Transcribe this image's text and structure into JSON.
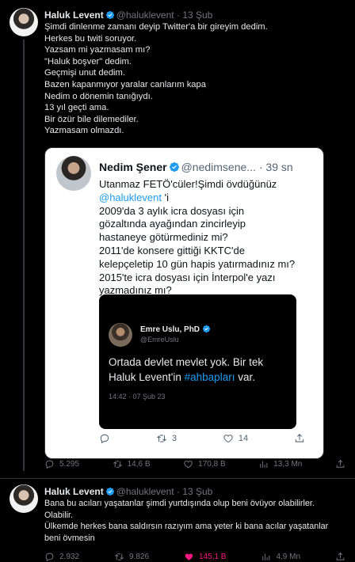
{
  "tweet1": {
    "name": "Haluk Levent",
    "handle": "@haluklevent",
    "sep": "·",
    "time": "13 Şub",
    "lines": [
      "Şimdi dinlenme zamanı deyip Twitter'a bir gireyim dedim.",
      "Herkes bu twiti soruyor.",
      "Yazsam mi yazmasam mı?",
      "\"Haluk boşver\" dedim.",
      "Geçmişi unut dedim.",
      "Bazen kapanmıyor yaralar canlarım kapa",
      "Nedim o dönemin tanığıydı.",
      "13 yıl geçti ama.",
      "Bir özür bile dilemediler.",
      "Yazmasam olmazdı."
    ],
    "stats": {
      "replies": "5.295",
      "retweets": "14,6 B",
      "likes": "170,8 B",
      "views": "13,3 Mn"
    }
  },
  "quoted": {
    "name": "Nedim Şener",
    "handle": "@nedimsene...",
    "sep": "·",
    "time": "39 sn",
    "line1": "Utanmaz FETÖ'cüler!Şimdi övdüğünüz",
    "mention": "@haluklevent",
    "mention_tail": " 'i",
    "lines": [
      "2009'da 3 aylık icra dosyası için",
      "gözaltında ayağından zincirleyip",
      "hastaneye götürmediniz mi?",
      "2011'de konsere gittiği KKTC'de",
      "kelepçeletip 10 gün hapis yatırmadınız mı?",
      "2015'te icra dosyası için İnterpol'e yazı",
      "yazmadınız mı?"
    ],
    "stats": {
      "retweets": "3",
      "likes": "14"
    }
  },
  "inner": {
    "name": "Emre Uslu, PhD",
    "handle": "@EmreUslu",
    "line1": "Ortada devlet mevlet yok. Bir tek",
    "line2_pre": "Haluk Levent'in ",
    "hashtag": "#ahbapları",
    "line2_post": " var.",
    "timestamp": "14:42 · 07 Şub 23"
  },
  "tweet2": {
    "name": "Haluk Levent",
    "handle": "@haluklevent",
    "sep": "·",
    "time": "13 Şub",
    "lines": [
      "Bana bu acıları yaşatanlar şimdi yurtdışında olup beni övüyor olabilirler.",
      "Olabilir.",
      "Ülkemde herkes bana saldırsın razıyım ama yeter ki bana acılar yaşatanlar",
      "beni övmesin"
    ],
    "stats": {
      "replies": "2.932",
      "retweets": "9.826",
      "likes": "145,1 B",
      "views": "4,9 Mn"
    }
  },
  "colors": {
    "link": "#1d9bf0",
    "like_active": "#f91880",
    "muted": "#71767b"
  }
}
